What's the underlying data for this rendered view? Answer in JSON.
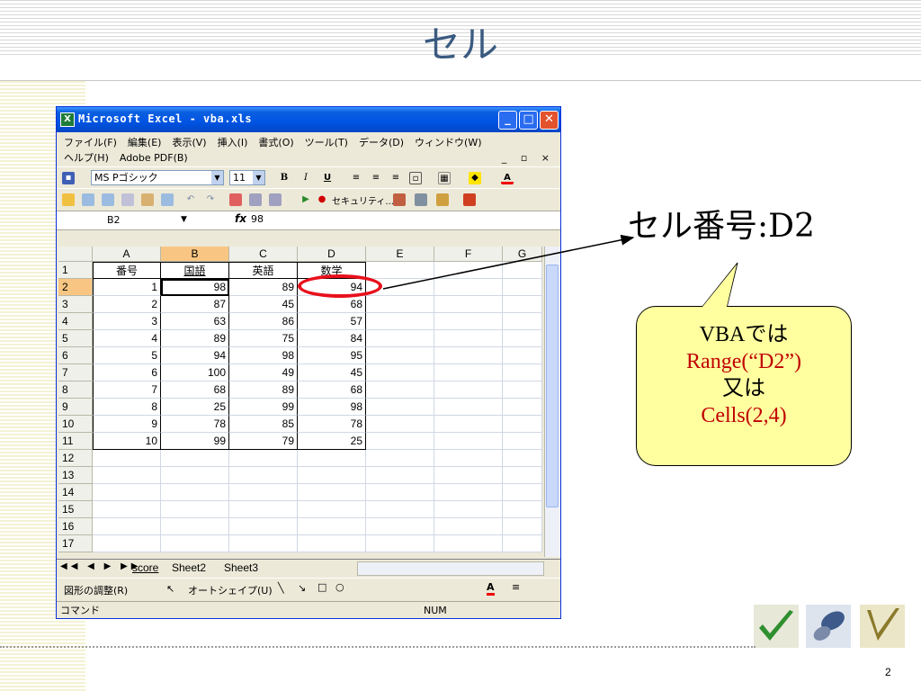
{
  "slide": {
    "title": "セル",
    "page_number": "2",
    "cell_label": "セル番号:D2",
    "callout": {
      "line1": "VBAでは",
      "line2": "Range(“D2”)",
      "line3": "又は",
      "line4": "Cells(2,4)"
    },
    "colors": {
      "title": "#3a5a80",
      "highlight_ring": "#e8101c",
      "callout_fill": "#ffffa0",
      "callout_red_text": "#c00000"
    }
  },
  "excel": {
    "window_title": "Microsoft Excel - vba.xls",
    "menu_row1": [
      "ファイル(F)",
      "編集(E)",
      "表示(V)",
      "挿入(I)",
      "書式(O)",
      "ツール(T)",
      "データ(D)",
      "ウィンドウ(W)"
    ],
    "menu_row2": [
      "ヘルプ(H)",
      "Adobe PDF(B)"
    ],
    "font_name": "MS Pゴシック",
    "font_size": "11",
    "format_buttons": {
      "bold": "B",
      "italic": "I",
      "underline": "U"
    },
    "security_label": "セキュリティ...",
    "name_box": "B2",
    "fx_symbol": "fx",
    "formula_value": "98",
    "col_headers": [
      "A",
      "B",
      "C",
      "D",
      "E",
      "F",
      "G"
    ],
    "row_headers": [
      "1",
      "2",
      "3",
      "4",
      "5",
      "6",
      "7",
      "8",
      "9",
      "10",
      "11",
      "12",
      "13",
      "14",
      "15",
      "16",
      "17"
    ],
    "rows": [
      [
        "番号",
        "国語",
        "英語",
        "数学"
      ],
      [
        "1",
        "98",
        "89",
        "94"
      ],
      [
        "2",
        "87",
        "45",
        "68"
      ],
      [
        "3",
        "63",
        "86",
        "57"
      ],
      [
        "4",
        "89",
        "75",
        "84"
      ],
      [
        "5",
        "94",
        "98",
        "95"
      ],
      [
        "6",
        "100",
        "49",
        "45"
      ],
      [
        "7",
        "68",
        "89",
        "68"
      ],
      [
        "8",
        "25",
        "99",
        "98"
      ],
      [
        "9",
        "78",
        "85",
        "78"
      ],
      [
        "10",
        "99",
        "79",
        "25"
      ]
    ],
    "sheet_tabs": [
      "score",
      "Sheet2",
      "Sheet3"
    ],
    "draw_toolbar": {
      "adjust": "図形の調整(R)",
      "autoshape": "オートシェイプ(U)"
    },
    "status_left": "コマンド",
    "status_num": "NUM"
  }
}
